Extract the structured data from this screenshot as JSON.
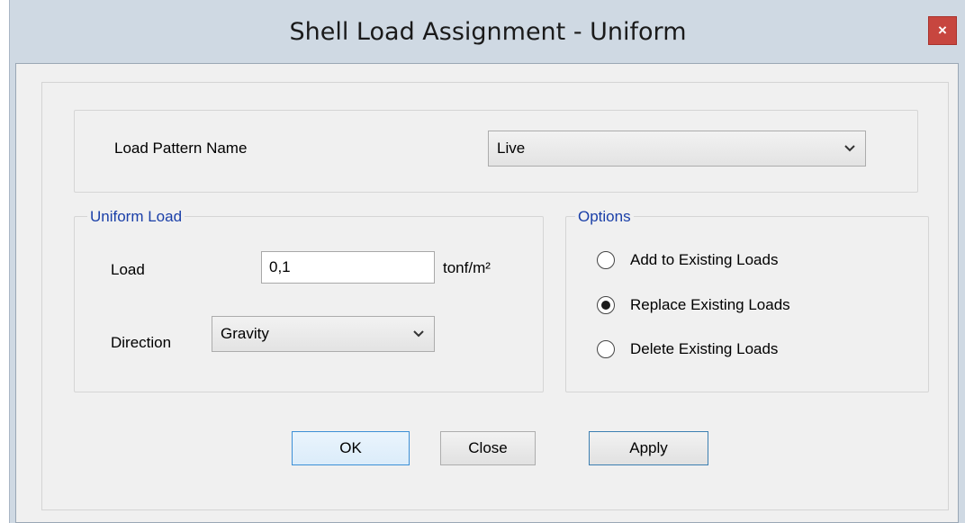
{
  "window": {
    "title": "Shell Load Assignment - Uniform",
    "close_label": "×"
  },
  "load_pattern": {
    "label": "Load Pattern Name",
    "selected": "Live"
  },
  "uniform_load": {
    "title": "Uniform Load",
    "load_label": "Load",
    "load_value": "0,1",
    "load_unit": "tonf/m²",
    "direction_label": "Direction",
    "direction_selected": "Gravity"
  },
  "options": {
    "title": "Options",
    "items": [
      {
        "label": "Add to Existing Loads",
        "checked": false
      },
      {
        "label": "Replace Existing Loads",
        "checked": true
      },
      {
        "label": "Delete Existing Loads",
        "checked": false
      }
    ]
  },
  "buttons": {
    "ok": "OK",
    "close": "Close",
    "apply": "Apply"
  },
  "colors": {
    "group_title": "#1a3fa8",
    "close_button": "#c7463f",
    "dialog_background": "#f0f0f0",
    "frame": "#cfd9e3"
  }
}
